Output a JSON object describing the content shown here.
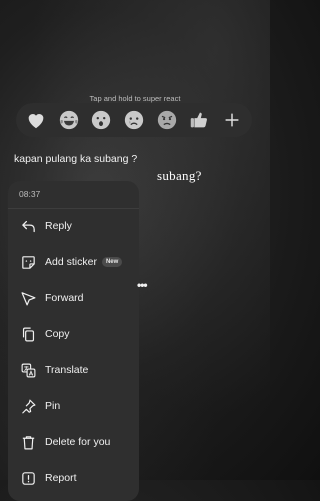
{
  "reactions": {
    "hint": "Tap and hold to super react",
    "emojis": [
      {
        "icon": "heart-icon"
      },
      {
        "icon": "tears-of-joy-icon"
      },
      {
        "icon": "surprised-face-icon"
      },
      {
        "icon": "crying-face-icon"
      },
      {
        "icon": "angry-face-icon"
      },
      {
        "icon": "thumbs-up-icon"
      }
    ],
    "more": "+"
  },
  "message": {
    "text": "kapan pulang ka subang ?",
    "overlay_text": "subang?"
  },
  "menu": {
    "time": "08:37",
    "items": [
      {
        "label": "Reply",
        "icon": "reply-icon"
      },
      {
        "label": "Add sticker",
        "icon": "sticker-icon",
        "badge": "New"
      },
      {
        "label": "Forward",
        "icon": "forward-icon"
      },
      {
        "label": "Copy",
        "icon": "copy-icon"
      },
      {
        "label": "Translate",
        "icon": "translate-icon"
      },
      {
        "label": "Pin",
        "icon": "pin-icon"
      },
      {
        "label": "Delete for you",
        "icon": "trash-icon"
      },
      {
        "label": "Report",
        "icon": "report-icon"
      }
    ],
    "more": "•••"
  }
}
